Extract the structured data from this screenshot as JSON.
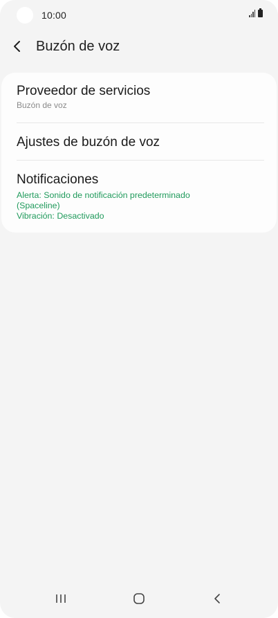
{
  "status_bar": {
    "time": "10:00"
  },
  "header": {
    "title": "Buzón de voz",
    "back_icon": "chevron-left-icon"
  },
  "list": {
    "items": [
      {
        "title": "Proveedor de servicios",
        "subtitle": "Buzón de voz"
      },
      {
        "title": "Ajustes de buzón de voz"
      },
      {
        "title": "Notificaciones",
        "detail_line1": "Alerta: Sonido de notificación predeterminado",
        "detail_line2": "(Spaceline)",
        "detail_line3": "Vibración: Desactivado"
      }
    ]
  },
  "nav_bar": {
    "recents_icon": "recents-icon",
    "home_icon": "home-icon",
    "back_icon": "back-icon"
  },
  "colors": {
    "background": "#f4f4f4",
    "card": "#fdfdfd",
    "accent_green": "#1f9a5b",
    "secondary_text": "#8a8a8a"
  }
}
